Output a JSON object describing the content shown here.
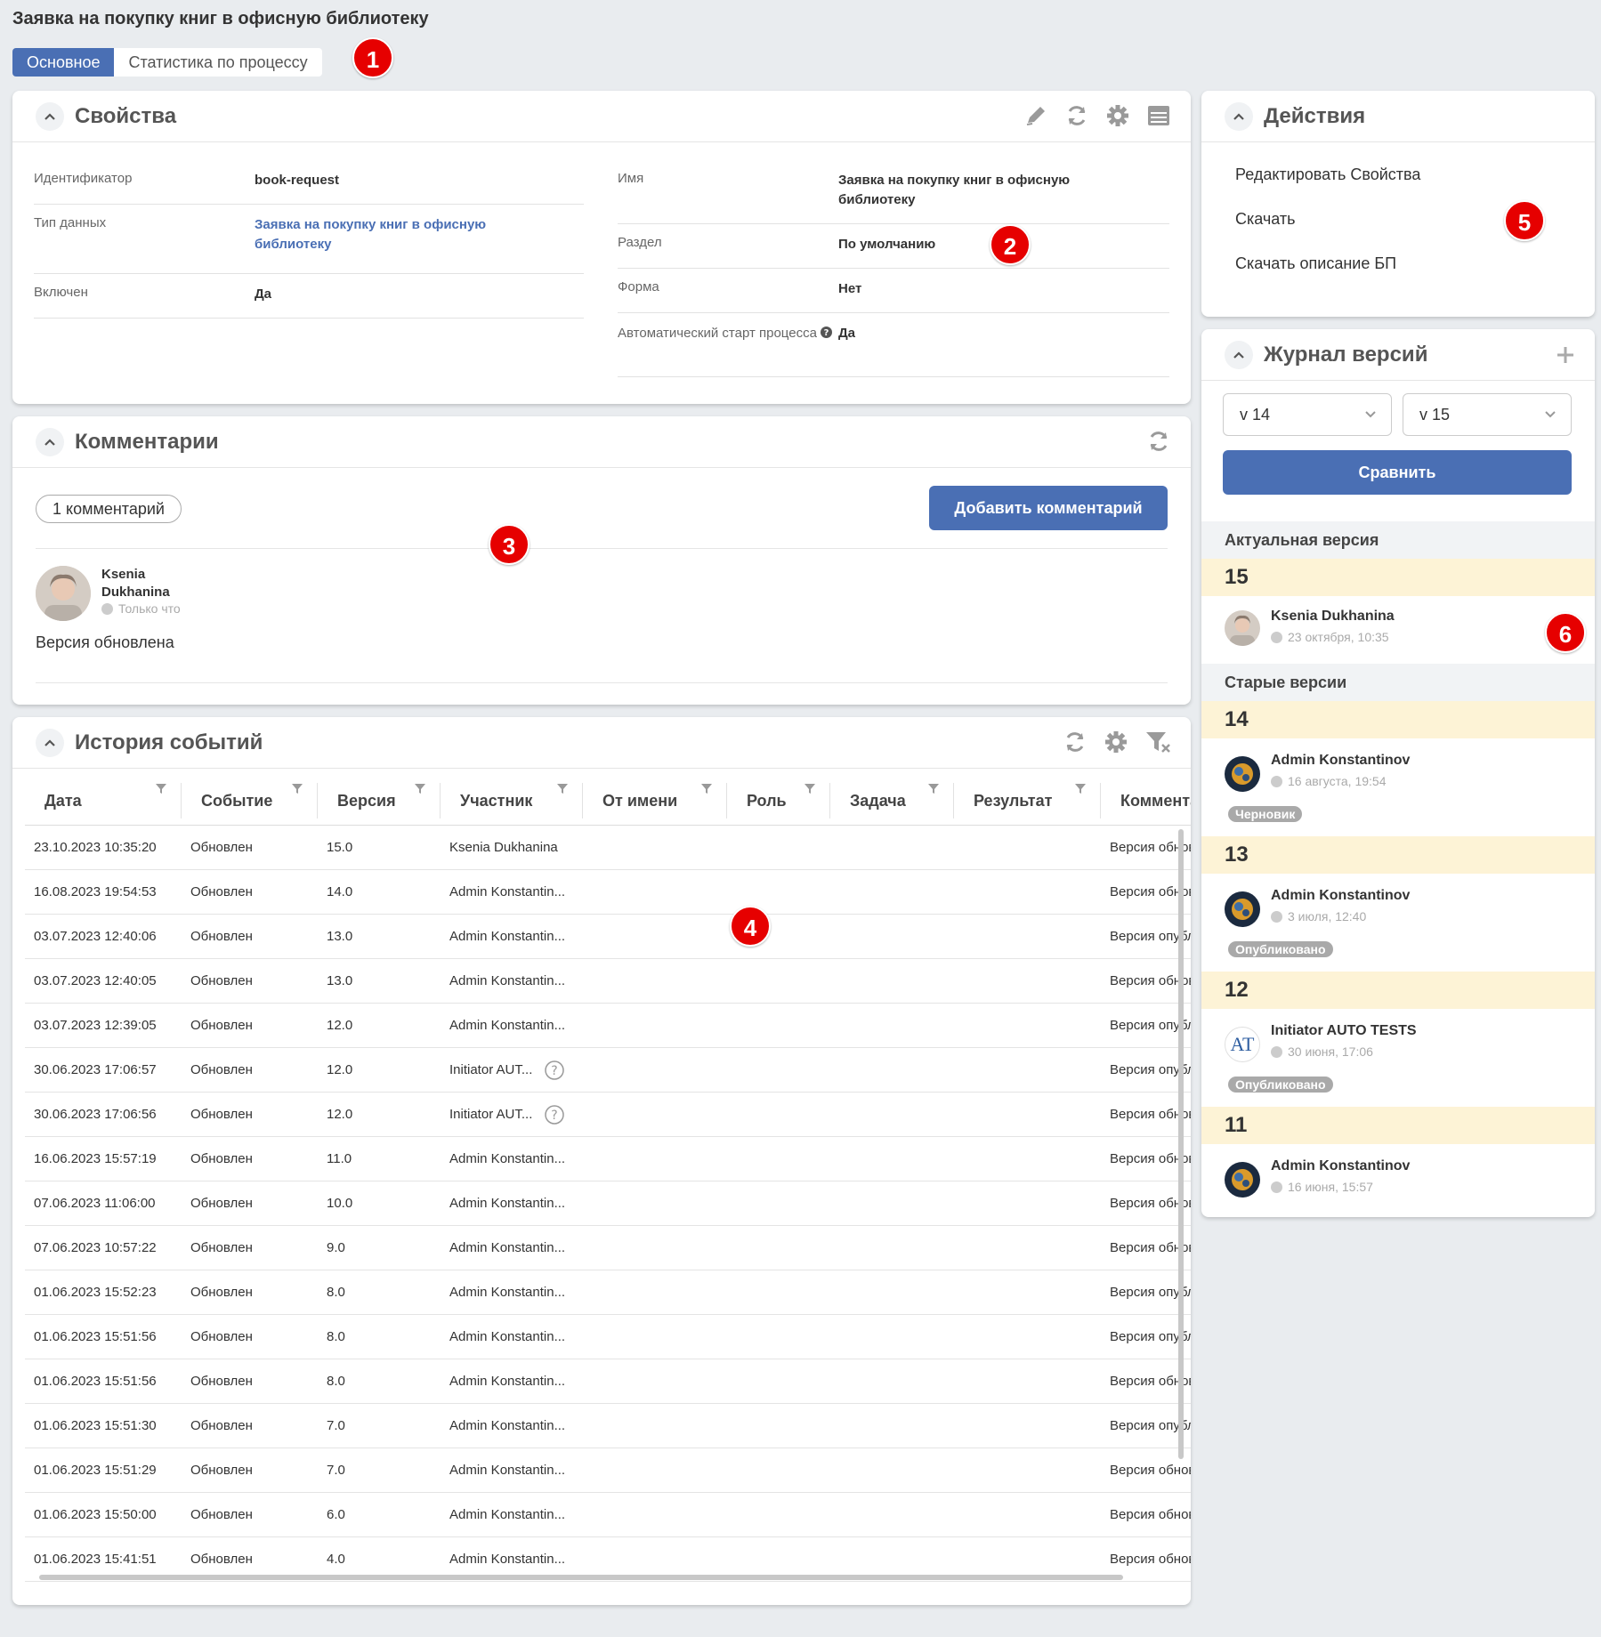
{
  "page": {
    "title": "Заявка на покупку книг в офисную библиотеку",
    "tabs": [
      "Основное",
      "Статистика по процессу"
    ]
  },
  "markers": [
    "1",
    "2",
    "3",
    "4",
    "5",
    "6"
  ],
  "properties": {
    "title": "Свойства",
    "left": [
      {
        "label": "Идентификатор",
        "value": "book-request"
      },
      {
        "label": "Тип данных",
        "value": "Заявка на покупку книг в офисную библиотеку"
      },
      {
        "label": "Включен",
        "value": "Да"
      }
    ],
    "right": [
      {
        "label": "Имя",
        "value": "Заявка на покупку книг в офисную библиотеку"
      },
      {
        "label": "Раздел",
        "value": "По умолчанию"
      },
      {
        "label": "Форма",
        "value": "Нет"
      },
      {
        "label": "Автоматический старт процесса",
        "value": "Да"
      }
    ]
  },
  "comments": {
    "title": "Комментарии",
    "count_label": "1 комментарий",
    "add_button": "Добавить комментарий",
    "items": [
      {
        "author_first": "Ksenia",
        "author_last": "Dukhanina",
        "time": "Только что",
        "text": "Версия обновлена"
      }
    ]
  },
  "history": {
    "title": "История событий",
    "columns": [
      "Дата",
      "Событие",
      "Версия",
      "Участник",
      "От имени",
      "Роль",
      "Задача",
      "Результат",
      "Комментарий"
    ],
    "rows": [
      {
        "date": "23.10.2023 10:35:20",
        "event": "Обновлен",
        "version": "15.0",
        "participant": "Ksenia Dukhanina",
        "help": false,
        "comment": "Версия обновлена"
      },
      {
        "date": "16.08.2023 19:54:53",
        "event": "Обновлен",
        "version": "14.0",
        "participant": "Admin Konstantin...",
        "help": false,
        "comment": "Версия обновлена"
      },
      {
        "date": "03.07.2023 12:40:06",
        "event": "Обновлен",
        "version": "13.0",
        "participant": "Admin Konstantin...",
        "help": false,
        "comment": "Версия опубликована"
      },
      {
        "date": "03.07.2023 12:40:05",
        "event": "Обновлен",
        "version": "13.0",
        "participant": "Admin Konstantin...",
        "help": false,
        "comment": "Версия обновлена"
      },
      {
        "date": "03.07.2023 12:39:05",
        "event": "Обновлен",
        "version": "12.0",
        "participant": "Admin Konstantin...",
        "help": false,
        "comment": "Версия опубликована"
      },
      {
        "date": "30.06.2023 17:06:57",
        "event": "Обновлен",
        "version": "12.0",
        "participant": "Initiator AUT...",
        "help": true,
        "comment": "Версия опубликована"
      },
      {
        "date": "30.06.2023 17:06:56",
        "event": "Обновлен",
        "version": "12.0",
        "participant": "Initiator AUT...",
        "help": true,
        "comment": "Версия обновлена"
      },
      {
        "date": "16.06.2023 15:57:19",
        "event": "Обновлен",
        "version": "11.0",
        "participant": "Admin Konstantin...",
        "help": false,
        "comment": "Версия обновлена"
      },
      {
        "date": "07.06.2023 11:06:00",
        "event": "Обновлен",
        "version": "10.0",
        "participant": "Admin Konstantin...",
        "help": false,
        "comment": "Версия обновлена"
      },
      {
        "date": "07.06.2023 10:57:22",
        "event": "Обновлен",
        "version": "9.0",
        "participant": "Admin Konstantin...",
        "help": false,
        "comment": "Версия обновлена"
      },
      {
        "date": "01.06.2023 15:52:23",
        "event": "Обновлен",
        "version": "8.0",
        "participant": "Admin Konstantin...",
        "help": false,
        "comment": "Версия опубликована"
      },
      {
        "date": "01.06.2023 15:51:56",
        "event": "Обновлен",
        "version": "8.0",
        "participant": "Admin Konstantin...",
        "help": false,
        "comment": "Версия опубликована"
      },
      {
        "date": "01.06.2023 15:51:56",
        "event": "Обновлен",
        "version": "8.0",
        "participant": "Admin Konstantin...",
        "help": false,
        "comment": "Версия обновлена"
      },
      {
        "date": "01.06.2023 15:51:30",
        "event": "Обновлен",
        "version": "7.0",
        "participant": "Admin Konstantin...",
        "help": false,
        "comment": "Версия опубликована"
      },
      {
        "date": "01.06.2023 15:51:29",
        "event": "Обновлен",
        "version": "7.0",
        "participant": "Admin Konstantin...",
        "help": false,
        "comment": "Версия обновлена"
      },
      {
        "date": "01.06.2023 15:50:00",
        "event": "Обновлен",
        "version": "6.0",
        "participant": "Admin Konstantin...",
        "help": false,
        "comment": "Версия обновлена"
      },
      {
        "date": "01.06.2023 15:41:51",
        "event": "Обновлен",
        "version": "4.0",
        "participant": "Admin Konstantin...",
        "help": false,
        "comment": "Версия обновлена"
      }
    ]
  },
  "actions": {
    "title": "Действия",
    "items": [
      "Редактировать Свойства",
      "Скачать",
      "Скачать описание БП"
    ]
  },
  "versions": {
    "title": "Журнал версий",
    "select_left": "v 14",
    "select_right": "v 15",
    "compare_button": "Сравнить",
    "current_label": "Актуальная версия",
    "old_label": "Старые версии",
    "current": {
      "number": "15",
      "author": "Ksenia Dukhanina",
      "time": "23 октября, 10:35"
    },
    "old": [
      {
        "number": "14",
        "author": "Admin Konstantinov",
        "time": "16 августа, 19:54",
        "badge": "Черновик",
        "avatar": "admin"
      },
      {
        "number": "13",
        "author": "Admin Konstantinov",
        "time": "3 июля, 12:40",
        "badge": "Опубликовано",
        "avatar": "admin"
      },
      {
        "number": "12",
        "author": "Initiator AUTO TESTS",
        "time": "30 июня, 17:06",
        "badge": "Опубликовано",
        "avatar": "initials",
        "initials": "AT"
      },
      {
        "number": "11",
        "author": "Admin Konstantinov",
        "time": "16 июня, 15:57",
        "badge": "",
        "avatar": "admin"
      }
    ]
  },
  "colors": {
    "primary": "#4a6fb4",
    "marker": "#e60000",
    "version_highlight": "#fdf3d6",
    "badge": "#a9a9a9"
  }
}
